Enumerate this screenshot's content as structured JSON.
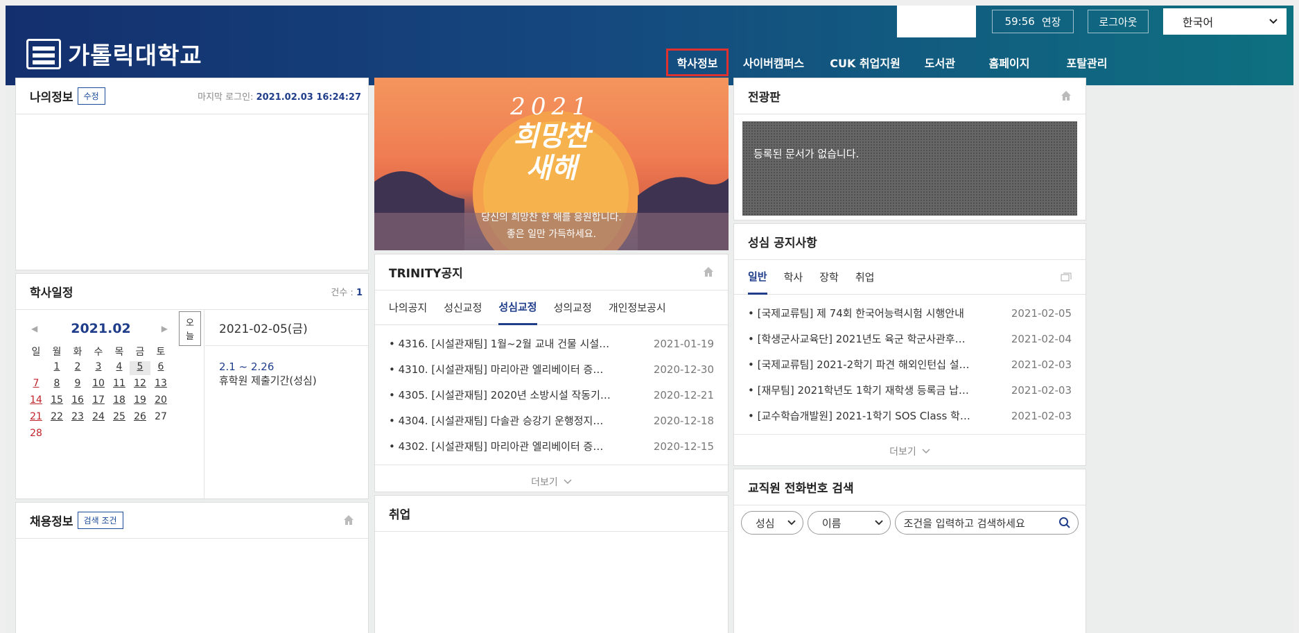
{
  "header": {
    "logo_text": "가톨릭대학교",
    "timer": "59:56",
    "extend": "연장",
    "logout": "로그아웃",
    "language": "한국어",
    "nav": [
      "학사정보",
      "사이버캠퍼스",
      "CUK 취업지원",
      "도서관",
      "홈페이지",
      "포탈관리"
    ]
  },
  "my_info": {
    "title": "나의정보",
    "edit": "수정",
    "last_login_label": "마지막 로그인:",
    "last_login": "2021.02.03 16:24:27"
  },
  "schedule": {
    "title": "학사일정",
    "count_label": "건수 :",
    "count": "1",
    "month": "2021.02",
    "today": "오늘",
    "weekdays": [
      "일",
      "월",
      "화",
      "수",
      "목",
      "금",
      "토"
    ],
    "days": [
      "",
      "1",
      "2",
      "3",
      "4",
      "5",
      "6",
      "7",
      "8",
      "9",
      "10",
      "11",
      "12",
      "13",
      "14",
      "15",
      "16",
      "17",
      "18",
      "19",
      "20",
      "21",
      "22",
      "23",
      "24",
      "25",
      "26",
      "27",
      "28"
    ],
    "selected_date": "2021-02-05(금)",
    "event_range": "2.1 ~ 2.26",
    "event_title": "휴학원 제출기간(성심)"
  },
  "jobs": {
    "title": "채용정보",
    "filter": "검색 조건"
  },
  "banner": {
    "year": "2021",
    "headline1": "희망찬",
    "headline2": "새해",
    "line1": "당신의 희망찬 한 해를 응원합니다.",
    "line2": "좋은 일만 가득하세요."
  },
  "trinity": {
    "title": "TRINITY공지",
    "tabs": [
      "나의공지",
      "성신교정",
      "성심교정",
      "성의교정",
      "개인정보공시"
    ],
    "items": [
      {
        "title": "• 4316. [시설관재팀] 1월~2월 교내 건물 시설…",
        "date": "2021-01-19"
      },
      {
        "title": "• 4310. [시설관재팀] 마리아관 엘리베이터 증…",
        "date": "2020-12-30"
      },
      {
        "title": "• 4305. [시설관재팀] 2020년 소방시설 작동기…",
        "date": "2020-12-21"
      },
      {
        "title": "• 4304. [시설관재팀] 다솔관 승강기 운행정지…",
        "date": "2020-12-18"
      },
      {
        "title": "• 4302. [시설관재팀] 마리아관 엘리베이터 증…",
        "date": "2020-12-15"
      }
    ],
    "more": "더보기"
  },
  "employment": {
    "title": "취업"
  },
  "board": {
    "title": "전광판",
    "empty": "등록된 문서가 없습니다."
  },
  "notices": {
    "title": "성심 공지사항",
    "tabs": [
      "일반",
      "학사",
      "장학",
      "취업"
    ],
    "items": [
      {
        "title": "• [국제교류팀] 제 74회 한국어능력시험 시행안내",
        "date": "2021-02-05"
      },
      {
        "title": "• [학생군사교육단] 2021년도 육군 학군사관후…",
        "date": "2021-02-04"
      },
      {
        "title": "• [국제교류팀] 2021-2학기 파견 해외인턴십 설…",
        "date": "2021-02-03"
      },
      {
        "title": "• [재무팀] 2021학년도 1학기 재학생 등록금 납…",
        "date": "2021-02-03"
      },
      {
        "title": "• [교수학습개발원] 2021-1학기 SOS Class 학…",
        "date": "2021-02-03"
      }
    ],
    "more": "더보기"
  },
  "phone_search": {
    "title": "교직원 전화번호 검색",
    "campus": "성심",
    "field": "이름",
    "placeholder": "조건을 입력하고 검색하세요"
  }
}
